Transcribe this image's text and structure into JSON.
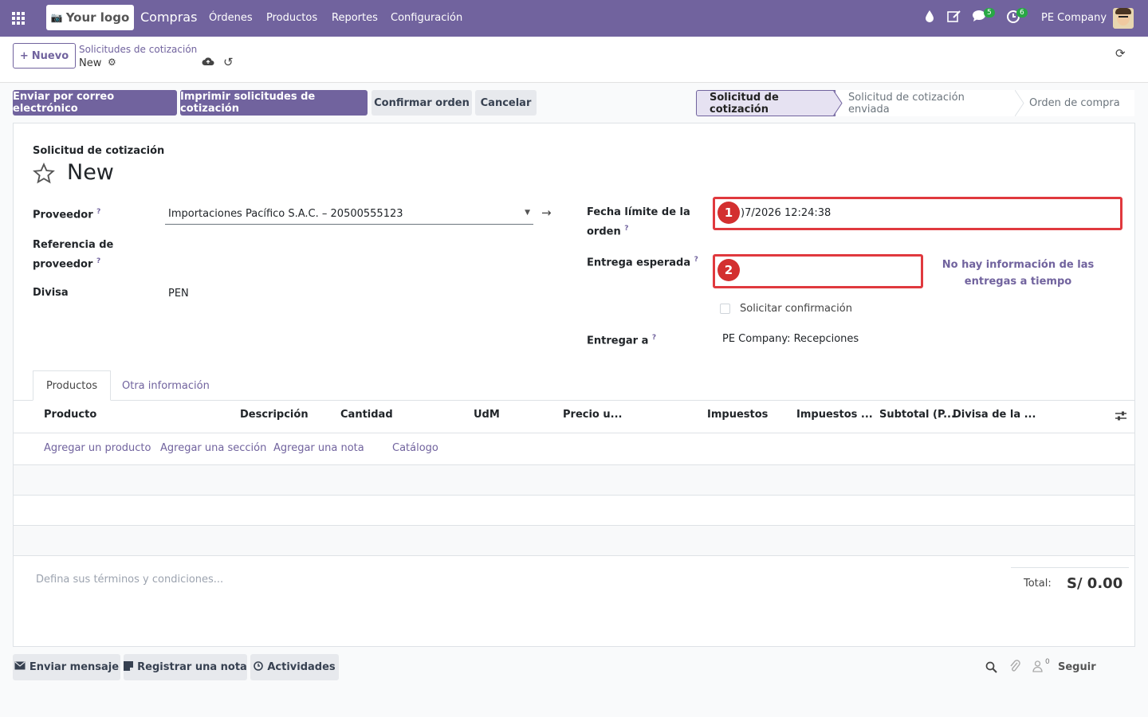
{
  "navbar": {
    "logo_text": "Your logo",
    "app_name": "Compras",
    "menu": [
      "Órdenes",
      "Productos",
      "Reportes",
      "Configuración"
    ],
    "messages_badge": "5",
    "activities_badge": "6",
    "company": "PE Company"
  },
  "control": {
    "new_button": "Nuevo",
    "breadcrumb_parent": "Solicitudes de cotización",
    "breadcrumb_current": "New"
  },
  "actions": {
    "email": "Enviar por correo electrónico",
    "print": "Imprimir solicitudes de cotización",
    "confirm": "Confirmar orden",
    "cancel": "Cancelar"
  },
  "status": {
    "stages": [
      "Solicitud de cotización",
      "Solicitud de cotización enviada",
      "Orden de compra"
    ],
    "active_index": 0
  },
  "form": {
    "doc_type": "Solicitud de cotización",
    "doc_name": "New",
    "vendor_label": "Proveedor",
    "vendor_value": "Importaciones Pacífico S.A.C. – 20500555123",
    "vendor_ref_label_1": "Referencia de",
    "vendor_ref_label_2": "proveedor",
    "currency_label": "Divisa",
    "currency_value": "PEN",
    "deadline_label_1": "Fecha límite de la",
    "deadline_label_2": "orden",
    "deadline_value": ")7/2026 12:24:38",
    "expected_label": "Entrega esperada",
    "ontime_info_1": "No hay información de las",
    "ontime_info_2": "entregas a tiempo",
    "confirm_request": "Solicitar confirmación",
    "deliver_to_label": "Entregar a",
    "deliver_to_value": "PE Company: Recepciones",
    "annotation_1": "1",
    "annotation_2": "2"
  },
  "tabs": [
    "Productos",
    "Otra información"
  ],
  "table": {
    "columns": [
      "Producto",
      "Descripción",
      "Cantidad",
      "UdM",
      "Precio u...",
      "Impuestos",
      "Impuestos ...",
      "Subtotal (P...",
      "Divisa de la ..."
    ],
    "add_links": [
      "Agregar un producto",
      "Agregar una sección",
      "Agregar una nota",
      "Catálogo"
    ]
  },
  "footer": {
    "terms_placeholder": "Defina sus términos y condiciones...",
    "total_label": "Total:",
    "total_value": "S/ 0.00"
  },
  "chatter": {
    "send_message": "Enviar mensaje",
    "log_note": "Registrar una nota",
    "activities": "Actividades",
    "followers_count": "0",
    "follow": "Seguir"
  },
  "colors": {
    "brand": "#71639e",
    "annotation": "#e0393e",
    "badge": "#28a745"
  }
}
